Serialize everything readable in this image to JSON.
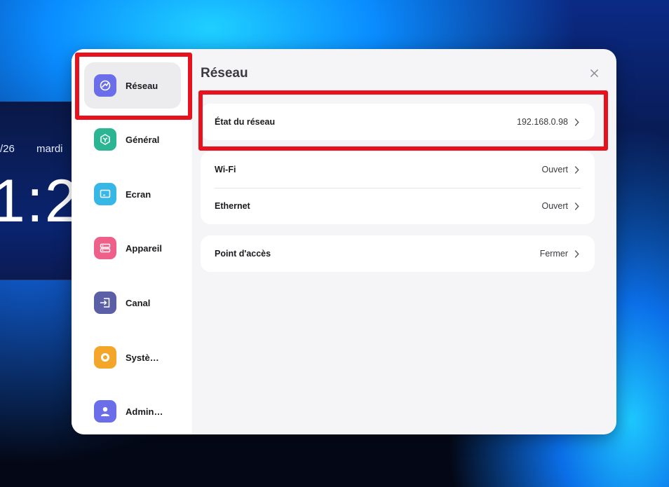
{
  "background": {
    "date_partial": "/26",
    "weekday": "mardi",
    "time_partial": "1:2"
  },
  "sidebar": {
    "items": [
      {
        "label": "Réseau",
        "icon": "network-icon",
        "color": "#6b6ee8",
        "active": true
      },
      {
        "label": "Général",
        "icon": "cube-icon",
        "color": "#2bb593",
        "active": false
      },
      {
        "label": "Ecran",
        "icon": "display-icon",
        "color": "#36b7e6",
        "active": false
      },
      {
        "label": "Appareil",
        "icon": "device-icon",
        "color": "#ee5f8a",
        "active": false
      },
      {
        "label": "Canal",
        "icon": "input-source-icon",
        "color": "#5a5fa8",
        "active": false
      },
      {
        "label": "Systè…",
        "icon": "system-icon",
        "color": "#f4a62a",
        "active": false
      },
      {
        "label": "Admin…",
        "icon": "admin-user-icon",
        "color": "#6b6ee8",
        "active": false
      }
    ]
  },
  "main": {
    "title": "Réseau",
    "groups": [
      [
        {
          "label": "État du réseau",
          "value": "192.168.0.98"
        }
      ],
      [
        {
          "label": "Wi-Fi",
          "value": "Ouvert"
        },
        {
          "label": "Ethernet",
          "value": "Ouvert"
        }
      ],
      [
        {
          "label": "Point d'accès",
          "value": "Fermer"
        }
      ]
    ]
  },
  "colors": {
    "highlight": "#e8121e",
    "dialog_bg": "#f5f5f7"
  }
}
